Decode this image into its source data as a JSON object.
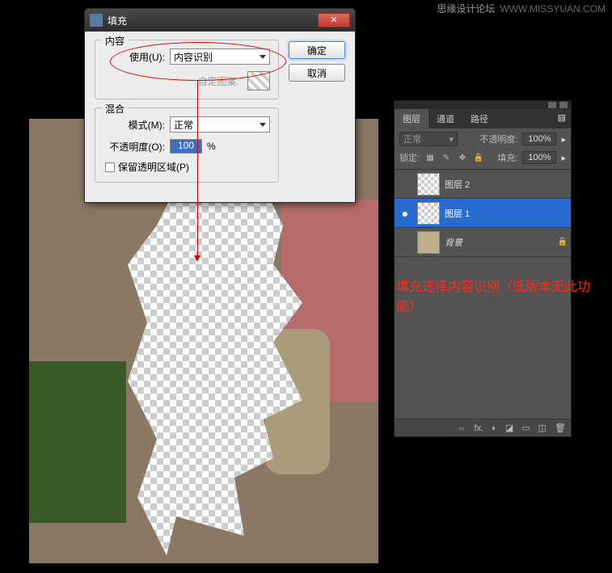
{
  "watermark": {
    "brand": "思缘设计论坛",
    "url": "WWW.MISSYUAN.COM"
  },
  "dialog": {
    "title": "填充",
    "ok": "确定",
    "cancel": "取消",
    "content": {
      "legend": "内容",
      "use_label": "使用(U):",
      "use_value": "内容识别",
      "pattern_label": "自定图案:"
    },
    "blend": {
      "legend": "混合",
      "mode_label": "模式(M):",
      "mode_value": "正常",
      "opacity_label": "不透明度(O):",
      "opacity_value": "100",
      "opacity_unit": "%",
      "preserve_label": "保留透明区域(P)"
    }
  },
  "panel": {
    "tabs": [
      "图层",
      "通道",
      "路径"
    ],
    "blend_mode": "正常",
    "opacity_label": "不透明度:",
    "opacity": "100%",
    "lock_label": "锁定:",
    "fill_label": "填充:",
    "fill": "100%",
    "layers": [
      {
        "name": "图层 2",
        "eye": "",
        "sel": false,
        "bg": false
      },
      {
        "name": "图层 1",
        "eye": "●",
        "sel": true,
        "bg": false
      },
      {
        "name": "背景",
        "eye": "",
        "sel": false,
        "bg": true
      }
    ],
    "footer_icons": [
      "⇔",
      "fx.",
      "◐",
      "◪",
      "▭",
      "◫",
      "🗑"
    ]
  },
  "note": "填充选择内容识别（低版本无此功能）"
}
